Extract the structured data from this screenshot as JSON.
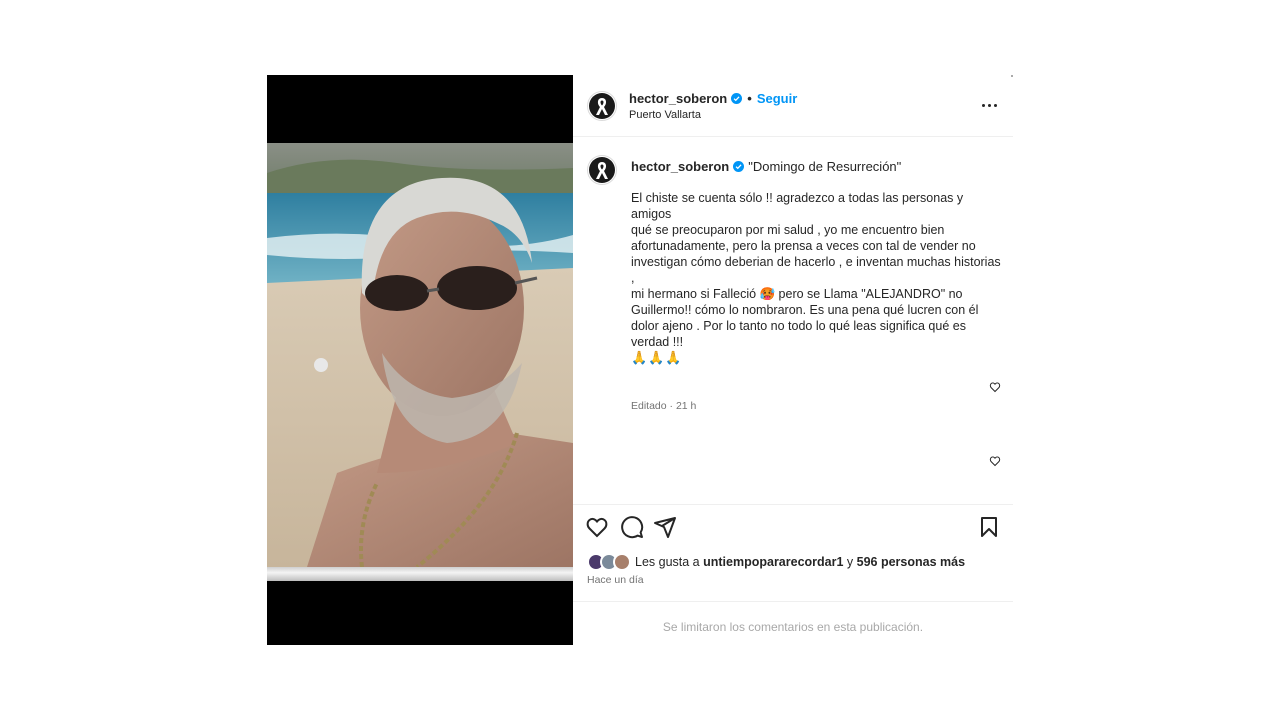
{
  "post": {
    "username": "hector_soberon",
    "follow_label": "Seguir",
    "location": "Puerto Vallarta",
    "caption_title": "\"Domingo de Resurreción\"",
    "caption_lines": [
      "El chiste se cuenta sólo !! agradezco a todas las personas y amigos",
      "qué se preocuparon por mi salud , yo me encuentro bien",
      "afortunadamente, pero la prensa a veces con tal de vender no",
      "investigan cómo deberian de hacerlo , e inventan muchas historias ,",
      "mi hermano si Falleció 🥵 pero se Llama \"ALEJANDRO\" no",
      "Guillermo!! cómo lo nombraron. Es una pena qué lucren con él",
      "dolor ajeno . Por lo tanto no todo lo qué leas significa qué es",
      "verdad !!!"
    ],
    "caption_emojis": "🙏🙏🙏",
    "caption_meta": "Editado · 21 h",
    "likes_prefix": "Les gusta a ",
    "likes_user": "untiempopararecordar1",
    "likes_middle": " y ",
    "likes_others": "596 personas más",
    "timestamp": "Hace un día",
    "comments_limited": "Se limitaron los comentarios en esta publicación."
  },
  "icons": {
    "verified": "verified-badge-icon",
    "more": "more-options-icon",
    "like": "heart-icon",
    "comment": "comment-icon",
    "share": "share-icon",
    "save": "bookmark-icon"
  },
  "colors": {
    "accent": "#0095f6",
    "text": "#262626",
    "secondary": "#737373",
    "muted": "#a8a8a8"
  }
}
